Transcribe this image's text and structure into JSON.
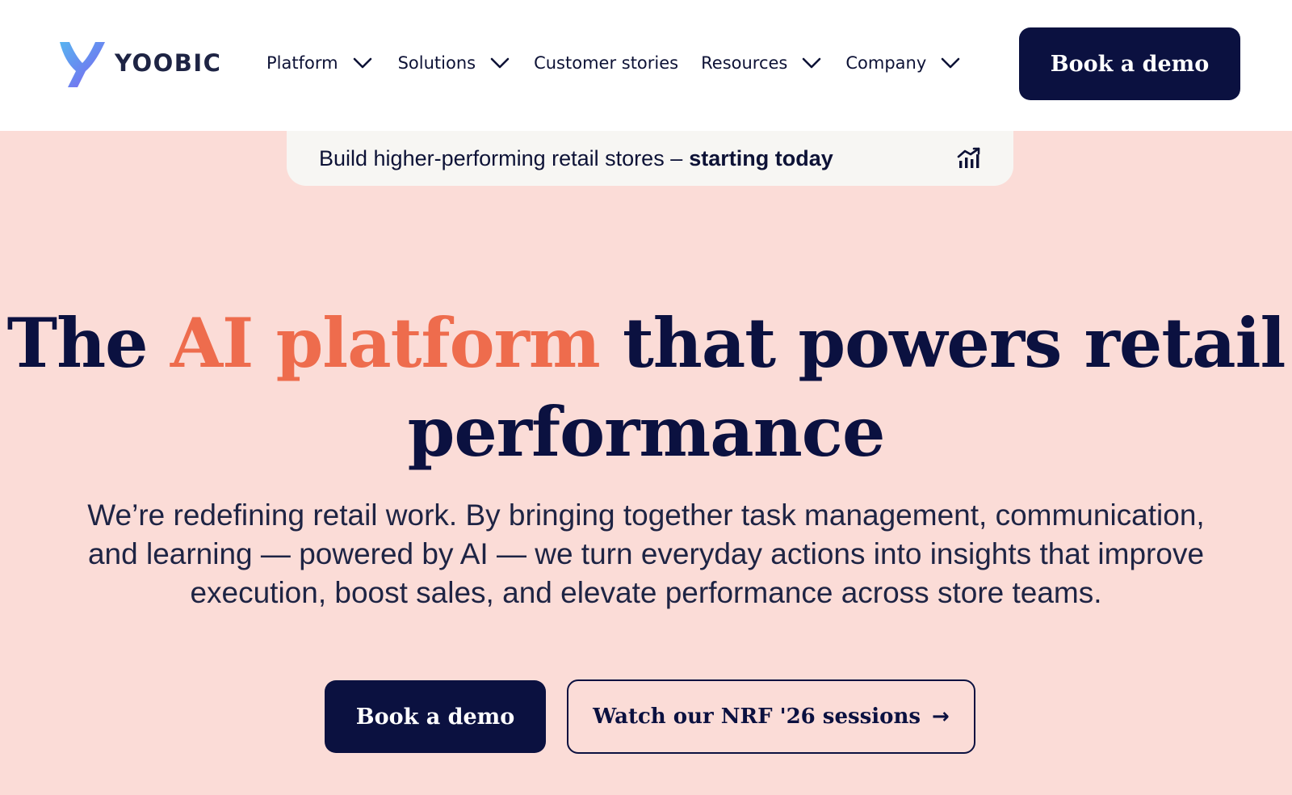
{
  "header": {
    "logo_text": "YOOBIC",
    "nav": [
      {
        "label": "Platform",
        "has_dropdown": true
      },
      {
        "label": "Solutions",
        "has_dropdown": true
      },
      {
        "label": "Customer stories",
        "has_dropdown": false
      },
      {
        "label": "Resources",
        "has_dropdown": true
      },
      {
        "label": "Company",
        "has_dropdown": true
      }
    ],
    "cta_label": "Book a demo"
  },
  "banner": {
    "text": "Build higher-performing retail stores –",
    "emphasis": "starting today",
    "icon": "chart-trend-icon"
  },
  "hero": {
    "title_start": "The",
    "title_accent": "AI platform",
    "title_end": "that powers retail performance",
    "subtitle": "We’re redefining retail work. By bringing together task management, communication, and learning — powered by AI — we turn everyday actions into insights that improve execution, boost sales, and elevate performance across store teams.",
    "primary_cta": "Book a demo",
    "secondary_cta": "Watch our NRF '26 sessions",
    "secondary_cta_icon": "→"
  },
  "colors": {
    "navy": "#0b1140",
    "accent": "#ee6c4d",
    "hero_background": "#fbdcd7",
    "banner_background": "#f7f6f3"
  }
}
